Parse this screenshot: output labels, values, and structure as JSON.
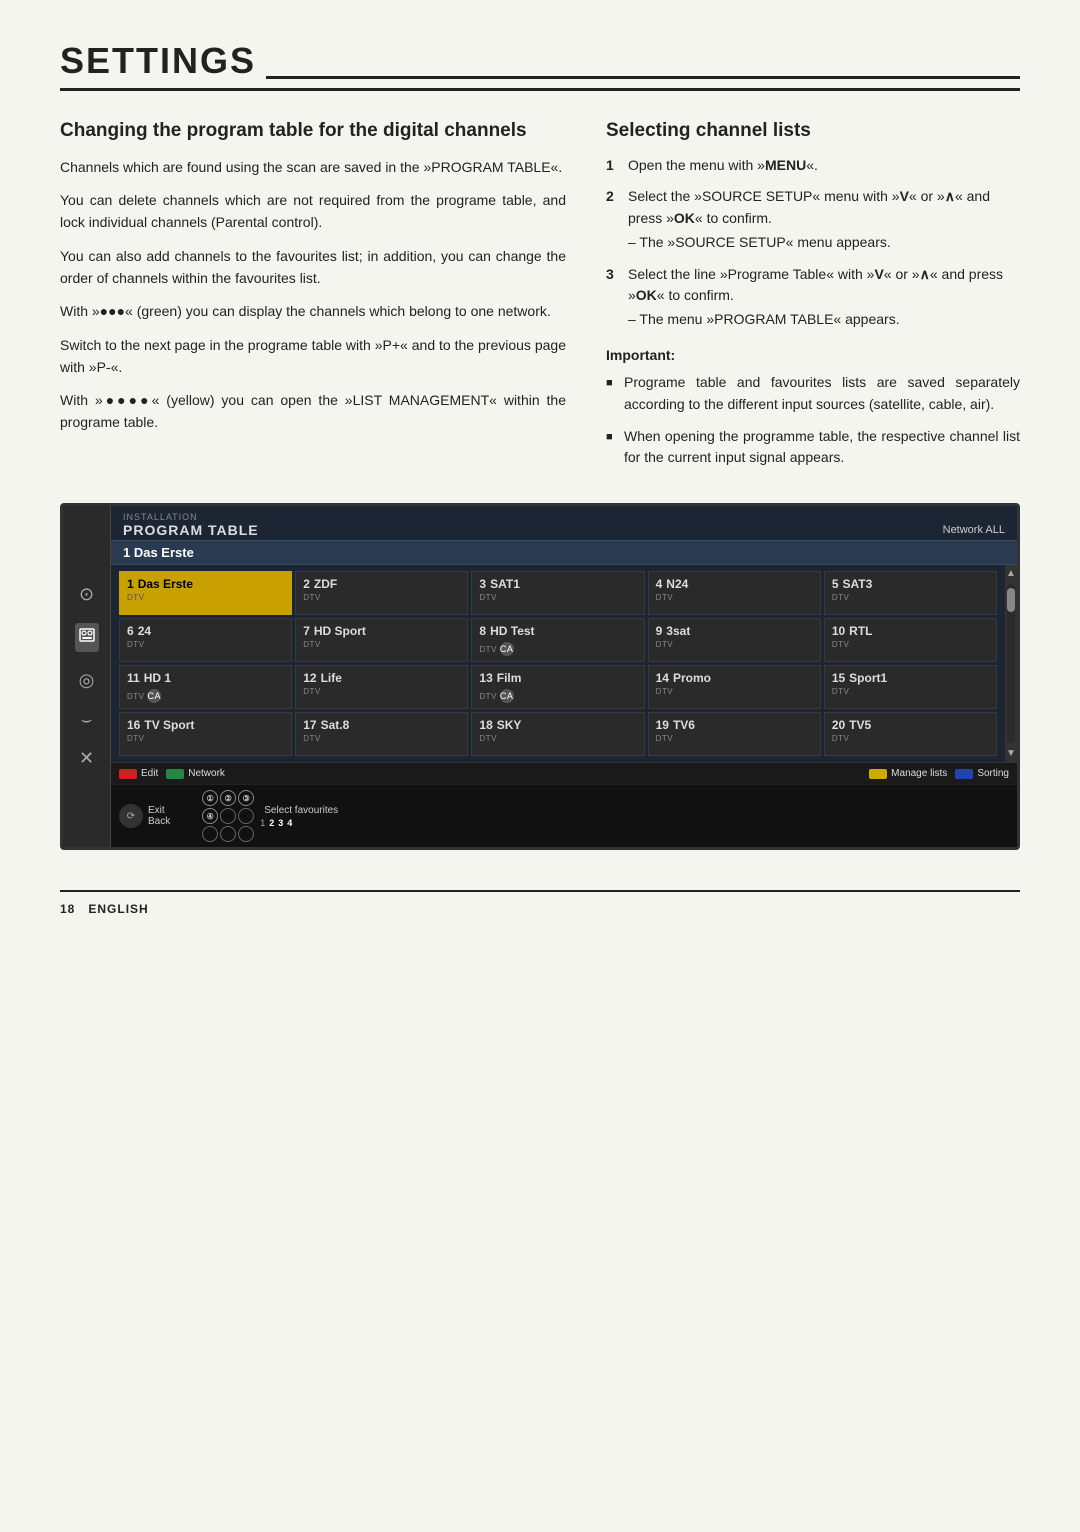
{
  "page": {
    "title": "SETTINGS",
    "footer_page": "18",
    "footer_lang": "ENGLISH"
  },
  "left_section": {
    "heading": "Changing the program table for the digital channels",
    "paragraphs": [
      "Channels which are found using the scan are saved in the »PROGRAM TABLE«.",
      "You can delete channels which are not required from the programe table, and lock individual channels (Parental control).",
      "You can also add channels to the favourites list; in addition, you can change the order of channels within the favourites list.",
      "With »●●●« (green) you can display the channels which belong to one network.",
      "Switch to the next page in the programe table with »P+« and to the previous page with »P-«.",
      "With »●●●●« (yellow) you can open the »LIST MANAGEMENT« within the programe table."
    ]
  },
  "right_section": {
    "heading": "Selecting channel lists",
    "steps": [
      {
        "num": "1",
        "text": "Open the menu with »MENU«.",
        "sub": ""
      },
      {
        "num": "2",
        "text": "Select the »SOURCE SETUP« menu with »V« or »∧« and press »OK« to confirm.",
        "sub": "– The »SOURCE SETUP« menu appears."
      },
      {
        "num": "3",
        "text": "Select the line »Programe Table« with »V« or »∧« and press »OK« to confirm.",
        "sub": "– The menu »PROGRAM TABLE« appears."
      }
    ],
    "important_label": "Important:",
    "important_items": [
      "Programe table and favourites lists are saved separately according to the different input sources (satellite, cable, air).",
      "When opening the programme table, the respective channel list for the current input signal appears."
    ]
  },
  "tv_screen": {
    "header_top": "INSTALLATION",
    "header_title": "PROGRAM TABLE",
    "header_right": "Network ALL",
    "selected_row": "1   Das Erste",
    "grid": [
      [
        {
          "num": "1",
          "name": "Das Erste",
          "type": "DTV",
          "ca": false,
          "highlighted": true
        },
        {
          "num": "2",
          "name": "ZDF",
          "type": "DTV",
          "ca": false,
          "highlighted": false
        },
        {
          "num": "3",
          "name": "SAT1",
          "type": "DTV",
          "ca": false,
          "highlighted": false
        },
        {
          "num": "4",
          "name": "N24",
          "type": "DTV",
          "ca": false,
          "highlighted": false
        },
        {
          "num": "5",
          "name": "SAT3",
          "type": "DTV",
          "ca": false,
          "highlighted": false
        }
      ],
      [
        {
          "num": "6",
          "name": "24",
          "type": "DTV",
          "ca": false,
          "highlighted": false
        },
        {
          "num": "7",
          "name": "HD Sport",
          "type": "DTV",
          "ca": false,
          "highlighted": false
        },
        {
          "num": "8",
          "name": "HD Test",
          "type": "DTV",
          "ca": true,
          "highlighted": false
        },
        {
          "num": "9",
          "name": "3sat",
          "type": "DTV",
          "ca": false,
          "highlighted": false
        },
        {
          "num": "10",
          "name": "RTL",
          "type": "DTV",
          "ca": false,
          "highlighted": false
        }
      ],
      [
        {
          "num": "11",
          "name": "HD 1",
          "type": "DTV",
          "ca": true,
          "highlighted": false
        },
        {
          "num": "12",
          "name": "Life",
          "type": "DTV",
          "ca": false,
          "highlighted": false
        },
        {
          "num": "13",
          "name": "Film",
          "type": "DTV",
          "ca": true,
          "highlighted": false
        },
        {
          "num": "14",
          "name": "Promo",
          "type": "DTV",
          "ca": false,
          "highlighted": false
        },
        {
          "num": "15",
          "name": "Sport1",
          "type": "DTV",
          "ca": false,
          "highlighted": false
        }
      ],
      [
        {
          "num": "16",
          "name": "TV Sport",
          "type": "DTV",
          "ca": false,
          "highlighted": false
        },
        {
          "num": "17",
          "name": "Sat.8",
          "type": "DTV",
          "ca": false,
          "highlighted": false
        },
        {
          "num": "18",
          "name": "SKY",
          "type": "DTV",
          "ca": false,
          "highlighted": false
        },
        {
          "num": "19",
          "name": "TV6",
          "type": "DTV",
          "ca": false,
          "highlighted": false
        },
        {
          "num": "20",
          "name": "TV5",
          "type": "DTV",
          "ca": false,
          "highlighted": false
        }
      ]
    ],
    "footer_buttons": [
      {
        "color": "red",
        "label": "Edit"
      },
      {
        "color": "green",
        "label": "Network"
      },
      {
        "color": "yellow",
        "label": "Manage lists"
      },
      {
        "color": "blue",
        "label": "Sorting"
      }
    ],
    "bottom_bar": {
      "exit_label": "Exit",
      "back_label": "Back",
      "select_favs_label": "Select favourites",
      "fav_circles": [
        {
          "label": "①",
          "active": false
        },
        {
          "label": "②",
          "active": false
        },
        {
          "label": "③",
          "active": false
        },
        {
          "label": "④",
          "active": false
        },
        {
          "label": "○",
          "active": false
        },
        {
          "label": "○",
          "active": false
        },
        {
          "label": "○",
          "active": false
        },
        {
          "label": "○",
          "active": false
        },
        {
          "label": "○",
          "active": false
        }
      ],
      "fav_row_nums": [
        "1",
        "2",
        "3",
        "4"
      ]
    }
  },
  "sidebar_icons": [
    {
      "name": "satellite-icon",
      "symbol": "⊙"
    },
    {
      "name": "recording-icon",
      "symbol": "⊞"
    },
    {
      "name": "settings-icon",
      "symbol": "◎"
    },
    {
      "name": "headphone-icon",
      "symbol": "⊃"
    },
    {
      "name": "tools-icon",
      "symbol": "✕"
    }
  ]
}
